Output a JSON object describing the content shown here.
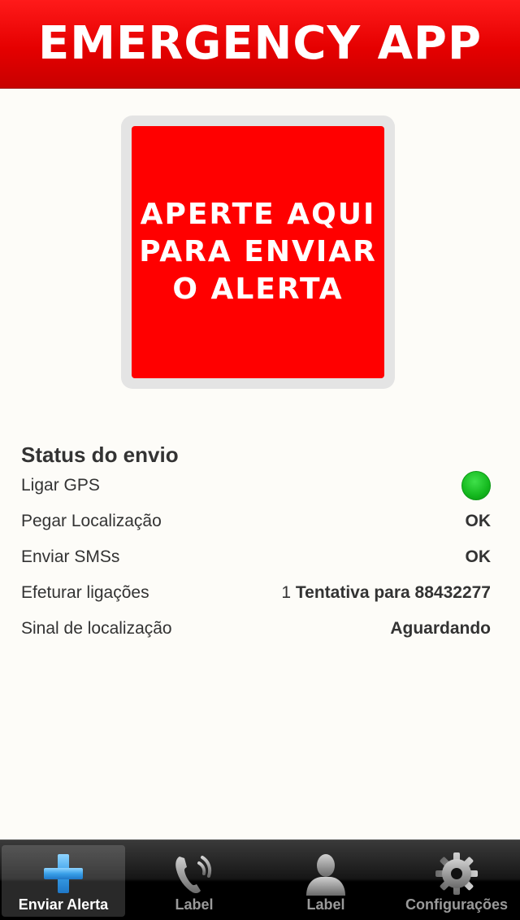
{
  "header": {
    "title": "EMERGENCY APP"
  },
  "alert_button": {
    "lines": [
      "APERTE AQUI",
      "PARA ENVIAR",
      "O ALERTA"
    ]
  },
  "status": {
    "title": "Status do envio",
    "rows": [
      {
        "label": "Ligar GPS",
        "indicator": "green"
      },
      {
        "label": "Pegar Localização",
        "value": "OK"
      },
      {
        "label": "Enviar SMSs",
        "value": "OK"
      },
      {
        "label": "Efeturar ligações",
        "count": "1",
        "value": "Tentativa para 88432277"
      },
      {
        "label": "Sinal de localização",
        "value": "Aguardando"
      }
    ]
  },
  "tabbar": {
    "tabs": [
      {
        "label": "Enviar Alerta",
        "icon": "plus-icon",
        "active": true
      },
      {
        "label": "Label",
        "icon": "phone-icon",
        "active": false
      },
      {
        "label": "Label",
        "icon": "person-icon",
        "active": false
      },
      {
        "label": "Configurações",
        "icon": "gear-icon",
        "active": false
      }
    ]
  },
  "colors": {
    "header_red": "#e50000",
    "button_red": "#ff0000",
    "gps_ok": "#14b81e",
    "tab_active_blue": "#3aa0e8"
  }
}
